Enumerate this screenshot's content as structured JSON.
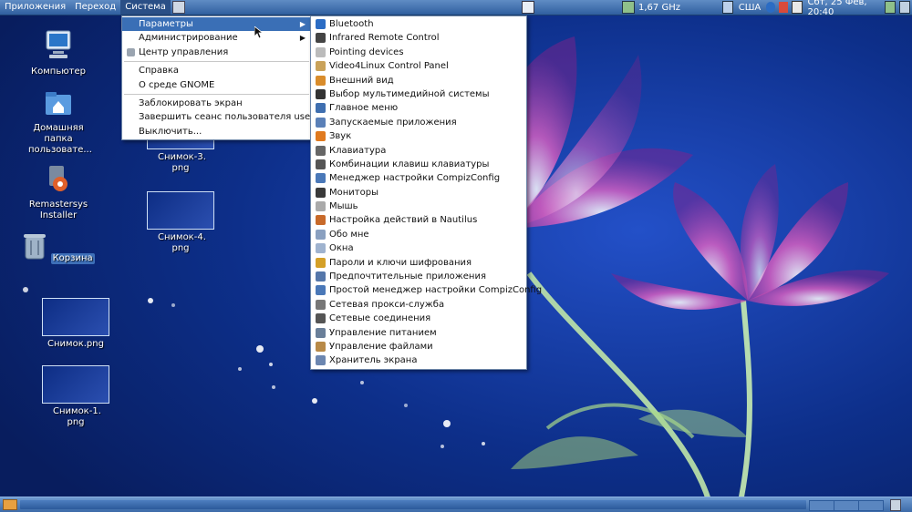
{
  "top_panel": {
    "menus": [
      "Приложения",
      "Переход",
      "Система"
    ],
    "cpu_freq": "1,67 GHz",
    "keyboard_layout": "США",
    "datetime": "Сбт, 25 Фев, 20:40"
  },
  "desktop_icons": [
    {
      "label": "Компьютер"
    },
    {
      "label": "Домашняя папка пользовате..."
    },
    {
      "label": "Remastersys Installer"
    },
    {
      "label": "Корзина"
    },
    {
      "label": "Снимок.png"
    },
    {
      "label": "Снимок-1. png"
    },
    {
      "label": "Снимок-3. png"
    },
    {
      "label": "Снимок-4. png"
    }
  ],
  "system_menu": {
    "items": [
      {
        "label": "Параметры"
      },
      {
        "label": "Администрирование"
      },
      {
        "label": "Центр управления"
      },
      {
        "label": "Справка"
      },
      {
        "label": "О среде GNOME"
      },
      {
        "label": "Заблокировать экран"
      },
      {
        "label": "Завершить сеанс пользователя user..."
      },
      {
        "label": "Выключить..."
      }
    ]
  },
  "preferences_menu": {
    "items": [
      {
        "label": "Bluetooth",
        "icon": "bluetooth-icon",
        "color": "#2b6cc4"
      },
      {
        "label": "Infrared Remote Control",
        "icon": "remote-icon",
        "color": "#444444"
      },
      {
        "label": "Pointing devices",
        "icon": "mouse-icon",
        "color": "#bbbbbb"
      },
      {
        "label": "Video4Linux Control Panel",
        "icon": "webcam-icon",
        "color": "#c9a25a"
      },
      {
        "label": "Внешний вид",
        "icon": "appearance-icon",
        "color": "#d98c2b"
      },
      {
        "label": "Выбор мультимедийной системы",
        "icon": "multimedia-icon",
        "color": "#333333"
      },
      {
        "label": "Главное меню",
        "icon": "main-menu-icon",
        "color": "#3f6fb0"
      },
      {
        "label": "Запускаемые приложения",
        "icon": "startup-apps-icon",
        "color": "#5a80b8"
      },
      {
        "label": "Звук",
        "icon": "sound-icon",
        "color": "#e07a1f"
      },
      {
        "label": "Клавиатура",
        "icon": "keyboard-icon",
        "color": "#666666"
      },
      {
        "label": "Комбинации клавиш клавиатуры",
        "icon": "shortcuts-icon",
        "color": "#555555"
      },
      {
        "label": "Менеджер настройки CompizConfig",
        "icon": "compiz-icon",
        "color": "#4a78b8"
      },
      {
        "label": "Мониторы",
        "icon": "monitor-icon",
        "color": "#3a3a3a"
      },
      {
        "label": "Мышь",
        "icon": "mouse-icon",
        "color": "#aaaaaa"
      },
      {
        "label": "Настройка действий в Nautilus",
        "icon": "nautilus-icon",
        "color": "#c86a2a"
      },
      {
        "label": "Обо мне",
        "icon": "about-me-icon",
        "color": "#8aa0c0"
      },
      {
        "label": "Окна",
        "icon": "windows-icon",
        "color": "#9fb3cf"
      },
      {
        "label": "Пароли и ключи шифрования",
        "icon": "key-icon",
        "color": "#d4a028"
      },
      {
        "label": "Предпочтительные приложения",
        "icon": "preferred-apps-icon",
        "color": "#5577aa"
      },
      {
        "label": "Простой менеджер настройки CompizConfig",
        "icon": "compiz-simple-icon",
        "color": "#4a78b8"
      },
      {
        "label": "Сетевая прокси-служба",
        "icon": "proxy-icon",
        "color": "#777777"
      },
      {
        "label": "Сетевые соединения",
        "icon": "network-icon",
        "color": "#555555"
      },
      {
        "label": "Управление питанием",
        "icon": "power-icon",
        "color": "#6a7f99"
      },
      {
        "label": "Управление файлами",
        "icon": "file-manager-icon",
        "color": "#b88a48"
      },
      {
        "label": "Хранитель экрана",
        "icon": "screensaver-icon",
        "color": "#6b86b0"
      }
    ]
  }
}
